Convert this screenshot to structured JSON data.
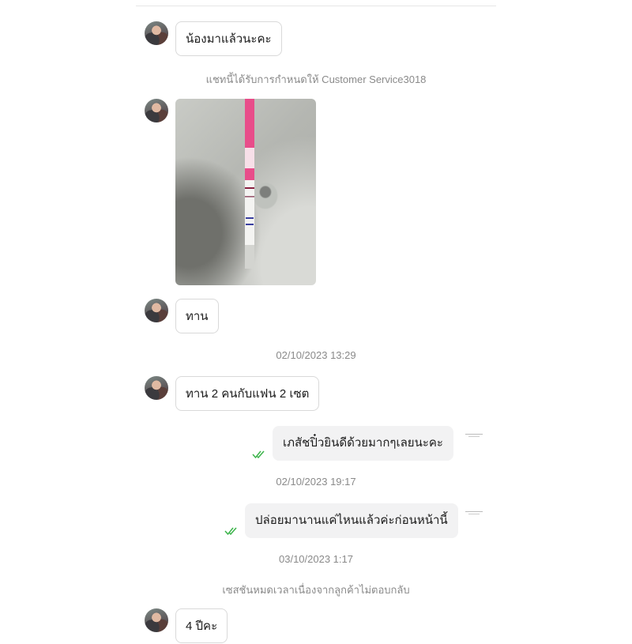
{
  "messages": [
    {
      "text": "น้องมาแล้วนะคะ"
    },
    {
      "text": "ทาน"
    },
    {
      "text": "ทาน 2 คนกับแฟน 2 เซต"
    },
    {
      "text": "เภสัชปิ๋วยินดีด้วยมากๆเลยนะคะ"
    },
    {
      "text": "ปล่อยมานานแค่ไหนแล้วค่ะก่อนหน้านี้"
    },
    {
      "text": "4 ปีคะ"
    }
  ],
  "system": {
    "assigned": "แชทนี้ได้รับการกำหนดให้ Customer Service3018",
    "timeout": "เซสชันหมดเวลาเนื่องจากลูกค้าไม่ตอบกลับ"
  },
  "timestamps": [
    "02/10/2023 13:29",
    "02/10/2023 19:17",
    "03/10/2023 1:17"
  ],
  "colors": {
    "check": "#3cb44b",
    "test_strip_pink": "#e84d8a",
    "test_strip_band": "#3a3fa0"
  },
  "icons": {
    "read_receipt": "double-check-icon",
    "agent_avatar": "shop-logo-icon",
    "customer_avatar": "user-avatar"
  }
}
